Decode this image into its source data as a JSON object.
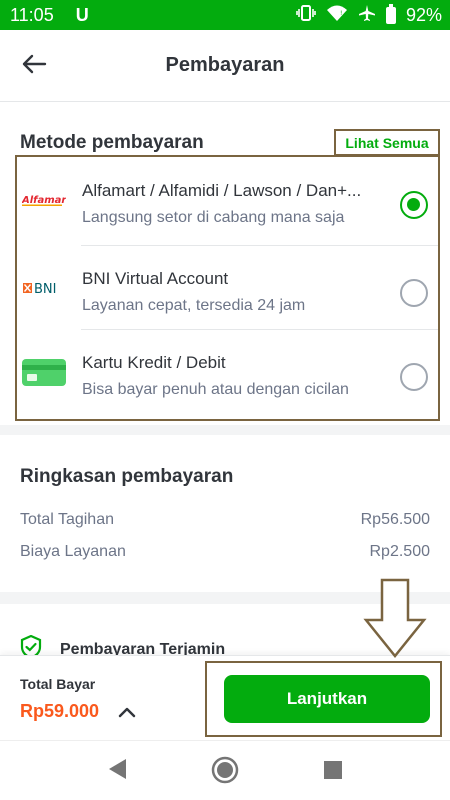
{
  "status_bar": {
    "time": "11:05",
    "app_icon": "U",
    "battery": "92%"
  },
  "header": {
    "title": "Pembayaran",
    "back_icon": "arrow-left-icon"
  },
  "payment_methods": {
    "title": "Metode pembayaran",
    "see_all": "Lihat Semua",
    "items": [
      {
        "logo_text": "Alfamart",
        "name": "Alfamart / Alfamidi / Lawson / Dan+...",
        "desc": "Langsung setor di cabang mana saja",
        "selected": true
      },
      {
        "logo_text": "BNI",
        "name": "BNI Virtual Account",
        "desc": "Layanan cepat, tersedia 24 jam",
        "selected": false
      },
      {
        "logo_text": "",
        "name": "Kartu Kredit / Debit",
        "desc": "Bisa bayar penuh atau dengan cicilan",
        "selected": false
      }
    ]
  },
  "summary": {
    "title": "Ringkasan pembayaran",
    "rows": [
      {
        "label": "Total Tagihan",
        "value": "Rp56.500"
      },
      {
        "label": "Biaya Layanan",
        "value": "Rp2.500"
      }
    ]
  },
  "guarantee": {
    "label": "Pembayaran Terjamin"
  },
  "bottom_bar": {
    "total_label": "Total Bayar",
    "total_value": "Rp59.000",
    "cta_label": "Lanjutkan"
  },
  "colors": {
    "accent": "#03ac0e",
    "price": "#fa591d",
    "annotation": "#7a6440"
  }
}
